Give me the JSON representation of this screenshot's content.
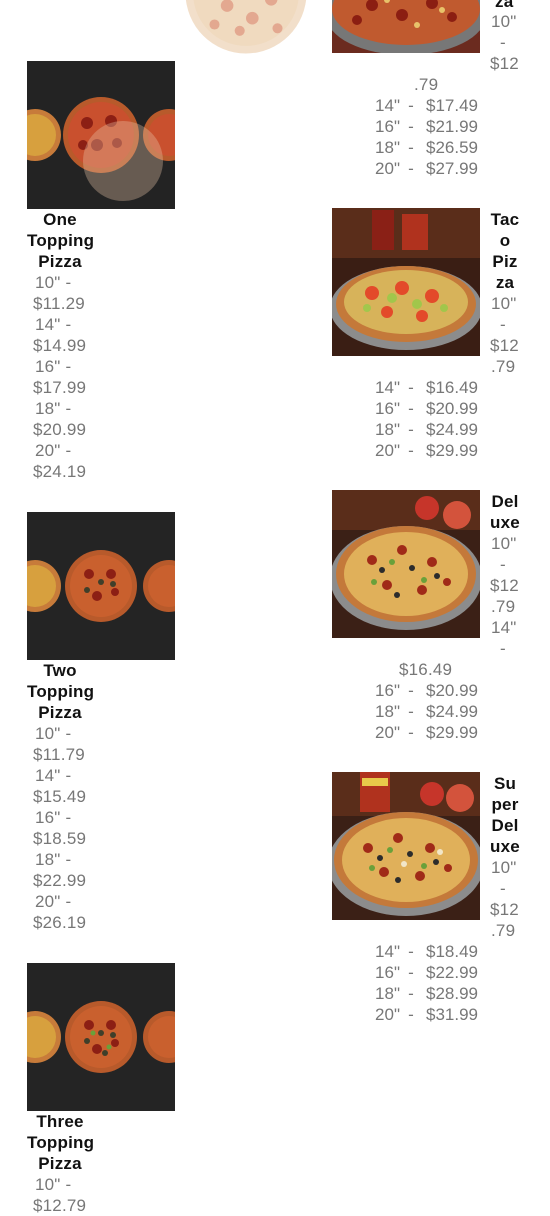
{
  "menu": {
    "top_partial": {
      "title_fragment": "za",
      "size_10": "10\"",
      "dash": "-",
      "price_10_part1": "$12",
      "price_10_part2": ".79",
      "rows": [
        {
          "size": "14\"",
          "dash": "-",
          "price": "$17.49"
        },
        {
          "size": "16\"",
          "dash": "-",
          "price": "$21.99"
        },
        {
          "size": "18\"",
          "dash": "-",
          "price": "$26.59"
        },
        {
          "size": "20\"",
          "dash": "-",
          "price": "$27.99"
        }
      ]
    },
    "one_topping": {
      "title": [
        "One",
        "Topping",
        "Pizza"
      ],
      "lines": [
        "10\"  -",
        "$11.29",
        "14\"  -",
        "$14.99",
        "16\"  -",
        "$17.99",
        "18\"  -",
        "$20.99",
        "20\"  -",
        "$24.19"
      ]
    },
    "taco": {
      "title": [
        "Tac",
        "o",
        "Piz",
        "za"
      ],
      "size_10": "10\"",
      "dash": "-",
      "price_10_part1": "$12",
      "price_10_part2": ".79",
      "rows": [
        {
          "size": "14\"",
          "dash": "-",
          "price": "$16.49"
        },
        {
          "size": "16\"",
          "dash": "-",
          "price": "$20.99"
        },
        {
          "size": "18\"",
          "dash": "-",
          "price": "$24.99"
        },
        {
          "size": "20\"",
          "dash": "-",
          "price": "$29.99"
        }
      ]
    },
    "two_topping": {
      "title": [
        "Two",
        "Topping",
        "Pizza"
      ],
      "lines": [
        "10\"  -",
        "$11.79",
        "14\"  -",
        "$15.49",
        "16\"  -",
        "$18.59",
        "18\"  -",
        "$22.99",
        "20\"  -",
        "$26.19"
      ]
    },
    "deluxe": {
      "title": [
        "Del",
        "uxe"
      ],
      "size_10": "10\"",
      "dash": "-",
      "price_10_part1": "$12",
      "price_10_part2": ".79",
      "size_14": "14\"",
      "dash_14": "-",
      "price_14": "$16.49",
      "rows": [
        {
          "size": "16\"",
          "dash": "-",
          "price": "$20.99"
        },
        {
          "size": "18\"",
          "dash": "-",
          "price": "$24.99"
        },
        {
          "size": "20\"",
          "dash": "-",
          "price": "$29.99"
        }
      ]
    },
    "super_deluxe": {
      "title": [
        "Su",
        "per",
        "Del",
        "uxe"
      ],
      "size_10": "10\"",
      "dash": "-",
      "price_10_part1": "$12",
      "price_10_part2": ".79",
      "rows": [
        {
          "size": "14\"",
          "dash": "-",
          "price": "$18.49"
        },
        {
          "size": "16\"",
          "dash": "-",
          "price": "$22.99"
        },
        {
          "size": "18\"",
          "dash": "-",
          "price": "$28.99"
        },
        {
          "size": "20\"",
          "dash": "-",
          "price": "$31.99"
        }
      ]
    },
    "three_topping": {
      "title": [
        "Three",
        "Topping",
        "Pizza"
      ],
      "lines": [
        "10\"  -",
        "$12.79"
      ]
    }
  }
}
